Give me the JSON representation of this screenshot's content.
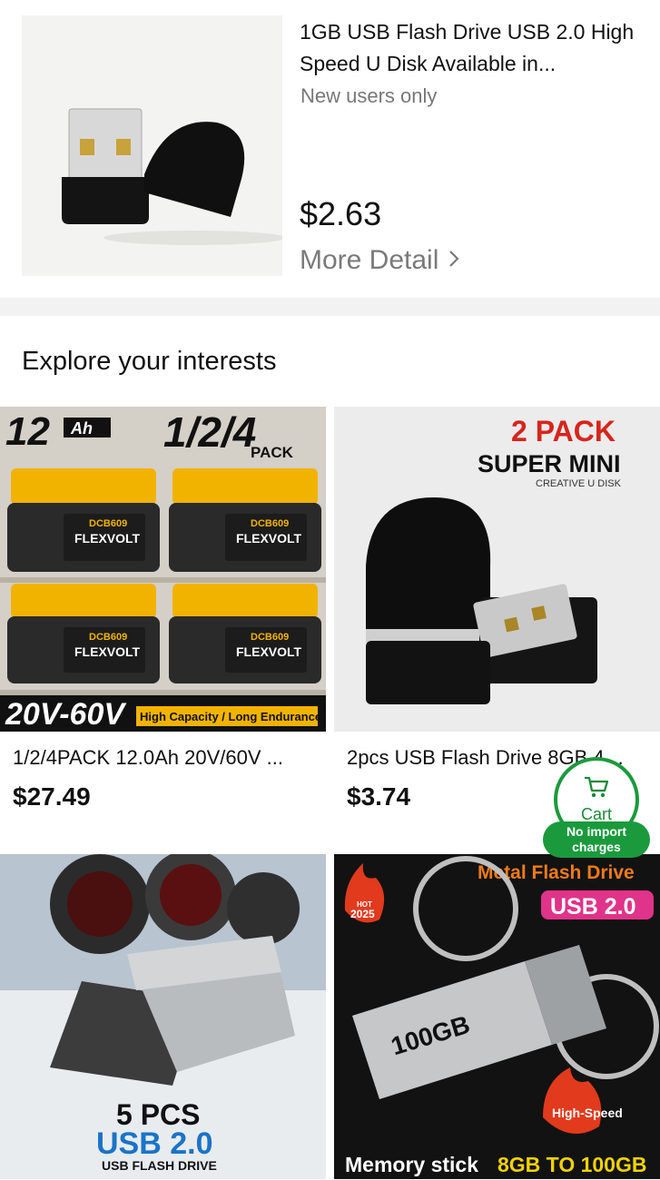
{
  "top_product": {
    "title": "1GB USB Flash Drive USB 2.0 High Speed U Disk Available in...",
    "subtitle": "New users only",
    "price": "$2.63",
    "more_label": "More Detail",
    "more_icon": "chevron-right-icon"
  },
  "section": {
    "title": "Explore your interests"
  },
  "products": [
    {
      "title": "1/2/4PACK 12.0Ah 20V/60V ...",
      "price": "$27.49",
      "image_text": {
        "capacity": "12",
        "ah": "Ah",
        "pack": "1/2/4",
        "pack_word": "PACK",
        "model": "DCB609",
        "brand": "FLEXVOLT",
        "volt": "20V-60V",
        "tagline": "High Capacity / Long Endurance"
      }
    },
    {
      "title": "2pcs USB Flash Drive 8GB 4G...",
      "price": "$3.74",
      "image_text": {
        "pack": "2 PACK",
        "headline": "SUPER MINI",
        "sub": "CREATIVE U DISK"
      }
    },
    {
      "title": "",
      "price": "",
      "image_text": {
        "pcs": "5 PCS",
        "usb": "USB 2.0",
        "sub": "USB FLASH DRIVE"
      }
    },
    {
      "title": "",
      "price": "",
      "image_text": {
        "headline": "Metal Flash Drive",
        "usb": "USB 2.0",
        "hot": "HOT",
        "year": "2025",
        "size": "100GB",
        "badge": "High-Speed",
        "footer_a": "Memory stick ",
        "footer_b": "8GB TO 100GB"
      }
    }
  ],
  "cart": {
    "label": "Cart",
    "icon": "cart-icon",
    "import_note": "No import charges"
  },
  "colors": {
    "accent_green": "#1a9a3c",
    "battery_yellow": "#f2b300",
    "usb_blue": "#1a73c8",
    "hot_red": "#e23a1c"
  }
}
